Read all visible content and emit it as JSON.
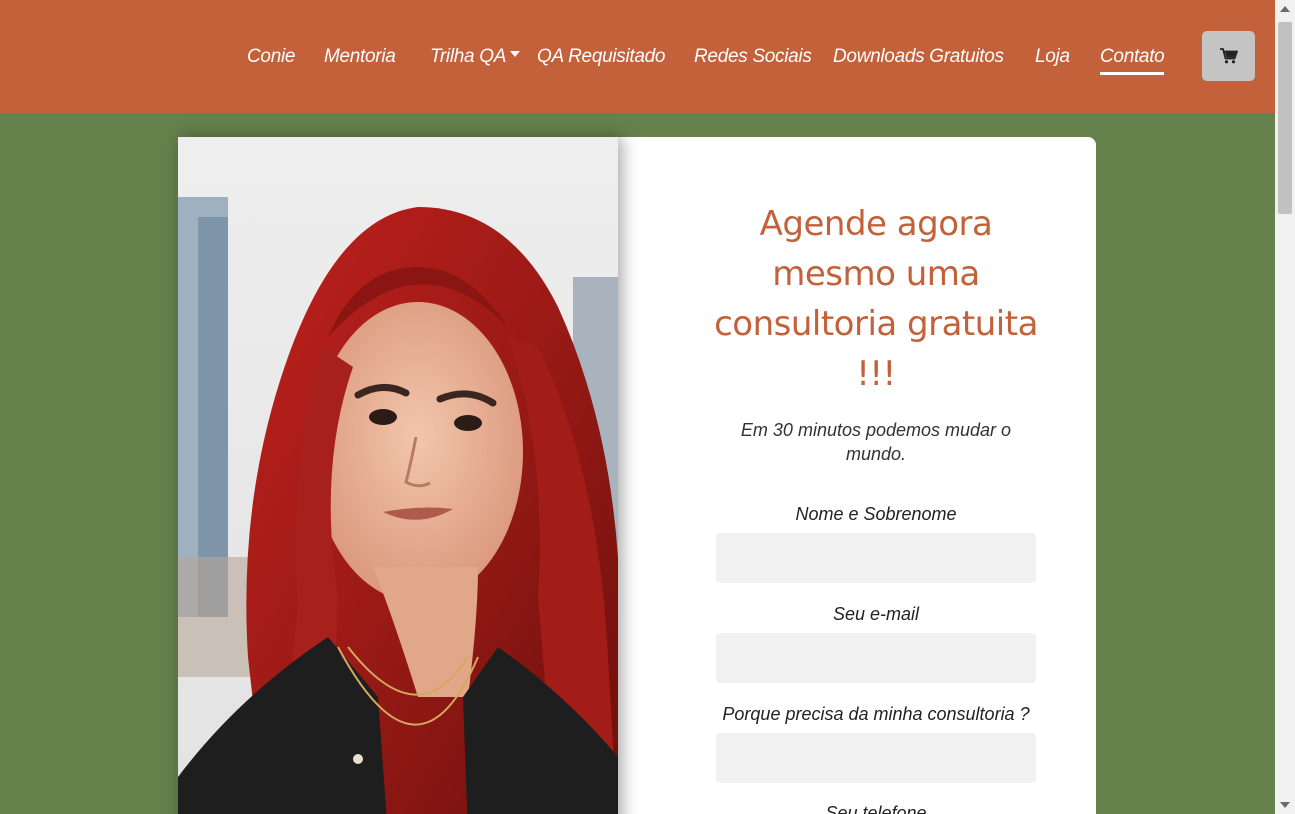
{
  "nav": {
    "items": [
      {
        "label": "Conie"
      },
      {
        "label": "Mentoria"
      },
      {
        "label": "Trilha QA"
      },
      {
        "label": "QA Requisitado"
      },
      {
        "label": "Redes Sociais"
      },
      {
        "label": "Downloads Gratuitos"
      },
      {
        "label": "Loja"
      },
      {
        "label": "Contato"
      }
    ],
    "cart_icon": "cart-icon"
  },
  "colors": {
    "header": "#c2613a",
    "background": "#65814c",
    "accent": "#c2613a",
    "input": "#f1f1f1"
  },
  "hero": {
    "photo_icon": "portrait-photo"
  },
  "form": {
    "headline": "Agende agora mesmo uma consultoria gratuita !!!",
    "subhead": "Em 30 minutos podemos mudar o mundo.",
    "fields": [
      {
        "label": "Nome e Sobrenome",
        "value": ""
      },
      {
        "label": "Seu e-mail",
        "value": ""
      },
      {
        "label": "Porque precisa da minha consultoria ?",
        "value": ""
      },
      {
        "label": "Seu telefone",
        "value": ""
      }
    ]
  }
}
